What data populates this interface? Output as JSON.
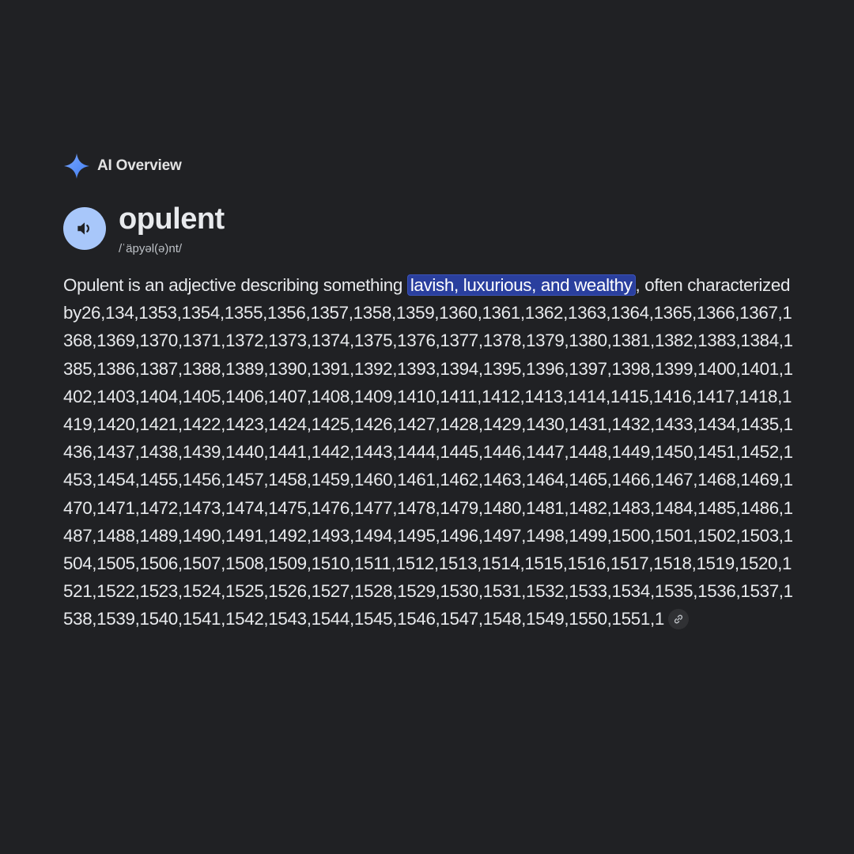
{
  "overview": {
    "label": "AI Overview",
    "icon": "sparkle-icon",
    "accent_color": "#4f86f7"
  },
  "definition": {
    "word": "opulent",
    "pronunciation": "/ˈäpyəl(ə)nt/",
    "speaker_icon": "speaker-icon",
    "text_before": "Opulent is an adjective describing something ",
    "highlighted": "lavish, luxurious, and wealthy",
    "text_after": ", often characterized ",
    "numbers_text": "by26,134,1353,1354,1355,1356,1357,1358,1359,1360,1361,1362,1363,1364,1365,1366,1367,1368,1369,1370,1371,1372,1373,1374,1375,1376,1377,1378,1379,1380,1381,1382,1383,1384,1385,1386,1387,1388,1389,1390,1391,1392,1393,1394,1395,1396,1397,1398,1399,1400,1401,1402,1403,1404,1405,1406,1407,1408,1409,1410,1411,1412,1413,1414,1415,1416,1417,1418,1419,1420,1421,1422,1423,1424,1425,1426,1427,1428,1429,1430,1431,1432,1433,1434,1435,1436,1437,1438,1439,1440,1441,1442,1443,1444,1445,1446,1447,1448,1449,1450,1451,1452,1453,1454,1455,1456,1457,1458,1459,1460,1461,1462,1463,1464,1465,1466,1467,1468,1469,1470,1471,1472,1473,1474,1475,1476,1477,1478,1479,1480,1481,1482,1483,1484,1485,1486,1487,1488,1489,1490,1491,1492,1493,1494,1495,1496,1497,1498,1499,1500,1501,1502,1503,1504,1505,1506,1507,1508,1509,1510,1511,1512,1513,1514,1515,1516,1517,1518,1519,1520,1521,1522,1523,1524,1525,1526,1527,1528,1529,1530,1531,1532,1533,1534,1535,1536,1537,1538,1539,1540,1541,1542,1543,1544,1545,1546,1547,1548,1549,1550,1551,1",
    "link_icon": "link-icon"
  },
  "colors": {
    "background": "#202124",
    "highlight_bg": "#2a3f9e",
    "speaker_bg": "#a8c7fa"
  }
}
